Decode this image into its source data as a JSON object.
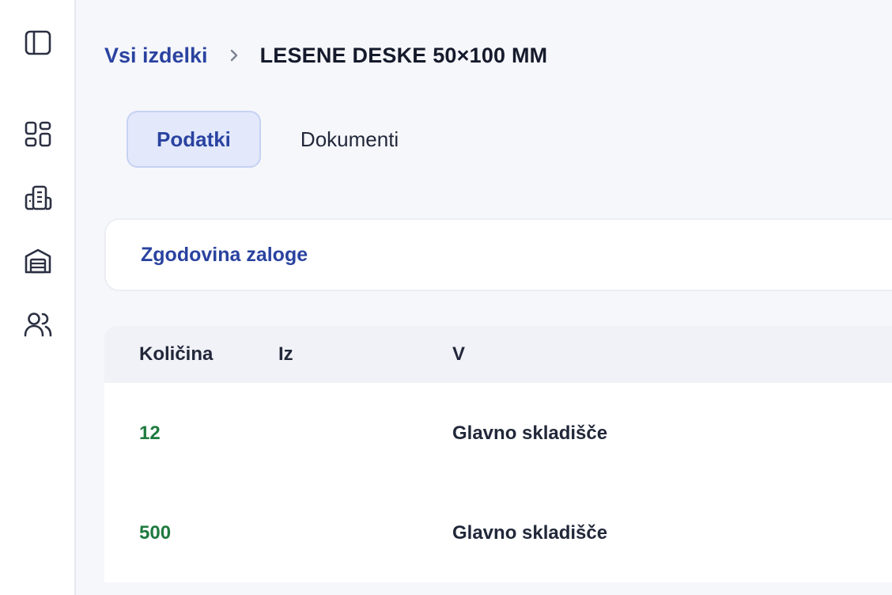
{
  "sidebar": {
    "items": [
      {
        "name": "sidebar-toggle",
        "icon": "panel-left-icon"
      },
      {
        "name": "dashboard",
        "icon": "grid-icon"
      },
      {
        "name": "products",
        "icon": "building-icon"
      },
      {
        "name": "warehouses",
        "icon": "warehouse-icon"
      },
      {
        "name": "users",
        "icon": "users-icon"
      }
    ]
  },
  "breadcrumb": {
    "root": "Vsi izdelki",
    "current": "LESENE DESKE 50×100 MM"
  },
  "tabs": [
    {
      "label": "Podatki",
      "active": true
    },
    {
      "label": "Dokumenti",
      "active": false
    }
  ],
  "section": {
    "title": "Zgodovina zaloge"
  },
  "table": {
    "headers": {
      "qty": "Količina",
      "from": "Iz",
      "to": "V"
    },
    "rows": [
      {
        "qty": "12",
        "from": "",
        "to": "Glavno skladišče"
      },
      {
        "qty": "500",
        "from": "",
        "to": "Glavno skladišče"
      }
    ]
  },
  "colors": {
    "accent": "#2a43a0",
    "positive": "#1f7a3f"
  }
}
